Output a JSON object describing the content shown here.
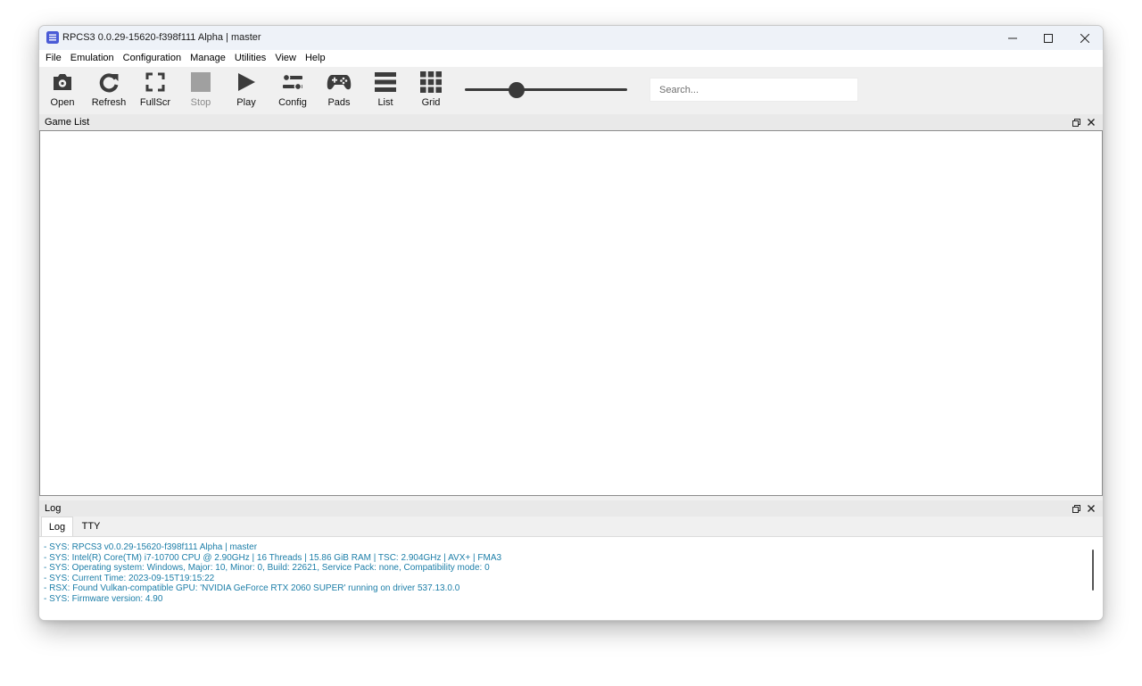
{
  "window": {
    "title": "RPCS3 0.0.29-15620-f398f111 Alpha | master",
    "accent_color": "#4a5bd6"
  },
  "menu": {
    "items": [
      "File",
      "Emulation",
      "Configuration",
      "Manage",
      "Utilities",
      "View",
      "Help"
    ]
  },
  "toolbar": {
    "open": "Open",
    "refresh": "Refresh",
    "fullscr": "FullScr",
    "stop": "Stop",
    "play": "Play",
    "config": "Config",
    "pads": "Pads",
    "list": "List",
    "grid": "Grid",
    "zoom_level": 0.32,
    "search_placeholder": "Search..."
  },
  "game_list": {
    "title": "Game List"
  },
  "log_panel": {
    "title": "Log",
    "tabs": [
      "Log",
      "TTY"
    ],
    "active_tab": 0,
    "text_color": "#1c7ea8",
    "lines": [
      "- SYS: RPCS3 v0.0.29-15620-f398f111 Alpha | master",
      "- SYS: Intel(R) Core(TM) i7-10700 CPU @ 2.90GHz | 16 Threads | 15.86 GiB RAM | TSC: 2.904GHz | AVX+ | FMA3",
      "- SYS: Operating system: Windows, Major: 10, Minor: 0, Build: 22621, Service Pack: none, Compatibility mode: 0",
      "- SYS: Current Time: 2023-09-15T19:15:22",
      "- RSX: Found Vulkan-compatible GPU: 'NVIDIA GeForce RTX 2060 SUPER' running on driver 537.13.0.0",
      "- SYS: Firmware version: 4.90"
    ]
  }
}
